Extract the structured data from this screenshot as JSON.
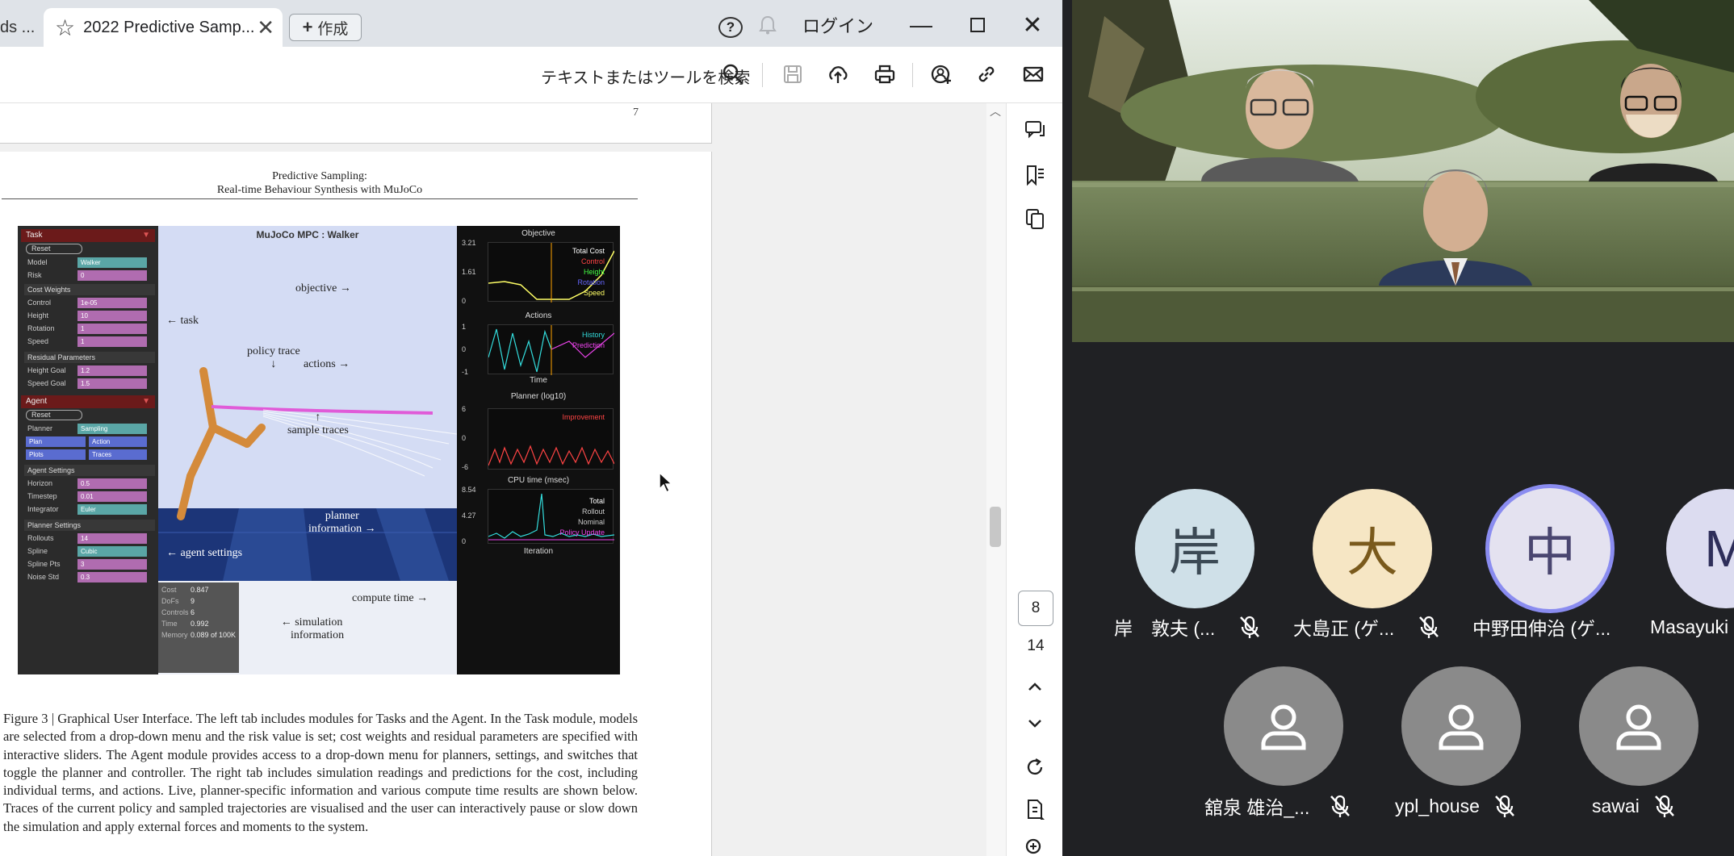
{
  "tabs": {
    "prev_label": "ds ...",
    "active_title": "2022 Predictive Samp...",
    "new_tab_label": "作成"
  },
  "window": {
    "login_label": "ログイン"
  },
  "toolbar": {
    "search_label": "テキストまたはツールを検索",
    "icons": [
      "search-icon",
      "save-icon",
      "upload-icon",
      "print-icon",
      "share-icon",
      "link-icon",
      "mail-icon"
    ]
  },
  "document": {
    "prev_page_number": "7",
    "header_line1": "Predictive Sampling:",
    "header_line2": "Real-time Behaviour Synthesis with MuJoCo",
    "figure": {
      "scene_title": "MuJoCo MPC : Walker",
      "annotations": {
        "objective": "objective",
        "task": "task",
        "policy_trace": "policy trace",
        "actions": "actions",
        "sample_traces": "sample traces",
        "planner_info_1": "planner",
        "planner_info_2": "information",
        "agent_settings": "agent settings",
        "compute_time": "compute time",
        "sim_info_1": "simulation",
        "sim_info_2": "information"
      },
      "left_panel": {
        "task_head": "Task",
        "reset": "Reset",
        "task_rows": [
          {
            "label": "Model",
            "value": "Walker"
          },
          {
            "label": "Risk",
            "value": "0"
          }
        ],
        "cost_weights": "Cost Weights",
        "cost_rows": [
          {
            "label": "Control",
            "value": "1e-05"
          },
          {
            "label": "Height",
            "value": "10"
          },
          {
            "label": "Rotation",
            "value": "1"
          },
          {
            "label": "Speed",
            "value": "1"
          }
        ],
        "residual": "Residual Parameters",
        "residual_rows": [
          {
            "label": "Height Goal",
            "value": "1.2"
          },
          {
            "label": "Speed Goal",
            "value": "1.5"
          }
        ],
        "agent_head": "Agent",
        "agent_reset": "Reset",
        "planner_label": "Planner",
        "planner_value": "Sampling",
        "plan": "Plan",
        "action": "Action",
        "plots": "Plots",
        "traces": "Traces",
        "agent_settings": "Agent Settings",
        "agent_rows": [
          {
            "label": "Horizon",
            "value": "0.5"
          },
          {
            "label": "Timestep",
            "value": "0.01"
          },
          {
            "label": "Integrator",
            "value": "Euler"
          }
        ],
        "planner_settings": "Planner Settings",
        "planner_rows": [
          {
            "label": "Rollouts",
            "value": "14"
          },
          {
            "label": "Spline",
            "value": "Cubic"
          },
          {
            "label": "Spline Pts",
            "value": "3"
          },
          {
            "label": "Noise Std",
            "value": "0.3"
          }
        ]
      },
      "sim_readout": [
        {
          "label": "Cost",
          "value": "0.847"
        },
        {
          "label": "DoFs",
          "value": "9"
        },
        {
          "label": "Controls",
          "value": "6"
        },
        {
          "label": "Time",
          "value": "0.992"
        },
        {
          "label": "Memory",
          "value": "0.089 of 100K"
        }
      ],
      "plots": {
        "objective_title": "Objective",
        "objective_ticks": [
          "3.21",
          "1.61",
          "0"
        ],
        "objective_legend": [
          "Total Cost",
          "Control",
          "Height",
          "Rotation",
          "Speed"
        ],
        "actions_title": "Actions",
        "actions_ticks": [
          "1",
          "0",
          "-1"
        ],
        "actions_legend": [
          "History",
          "Prediction"
        ],
        "actions_xlabel": "Time",
        "planner_title": "Planner (log10)",
        "planner_ticks": [
          "6",
          "0",
          "-6"
        ],
        "planner_legend": [
          "Improvement"
        ],
        "cpu_title": "CPU time (msec)",
        "cpu_ticks": [
          "8.54",
          "4.27",
          "0"
        ],
        "cpu_legend": [
          "Total",
          "Rollout",
          "Nominal",
          "Policy Update"
        ],
        "cpu_xlabel": "Iteration"
      }
    },
    "caption": "Figure 3 | Graphical User Interface. The left tab includes modules for Tasks and the Agent. In the Task module, models are selected from a drop-down menu and the risk value is set; cost weights and residual parameters are specified with interactive sliders. The Agent module provides access to a drop-down menu for planners, settings, and switches that toggle the planner and controller. The right tab includes simulation readings and predictions for the cost, including individual terms, and actions. Live, planner-specific information and various compute time results are shown below. Traces of the current policy and sampled trajectories are visualised and the user can interactively pause or slow down the simulation and apply external forces and moments to the system.",
    "current_page": "8",
    "total_pages": "14"
  },
  "meeting": {
    "participants": [
      {
        "initial": "岸",
        "name": "岸　敦夫 (...",
        "bg": "#cfe0e8",
        "fg": "#3c4a55"
      },
      {
        "initial": "大",
        "name": "大島正 (ゲ...",
        "bg": "#f6e6c4",
        "fg": "#7a5a1c"
      },
      {
        "initial": "中",
        "name": "中野田伸治 (ゲ...",
        "bg": "#e4e2f0",
        "fg": "#4a4670"
      },
      {
        "initial": "M",
        "name": "Masayuki",
        "bg": "#dcdcf0",
        "fg": "#2e2e5a"
      },
      {
        "initial": "",
        "name": "舘泉 雄治_...",
        "bg": "#8a8a8a",
        "fg": "#ffffff"
      },
      {
        "initial": "",
        "name": "ypl_house",
        "bg": "#8a8a8a",
        "fg": "#ffffff"
      },
      {
        "initial": "",
        "name": "sawai",
        "bg": "#8a8a8a",
        "fg": "#ffffff"
      }
    ]
  }
}
